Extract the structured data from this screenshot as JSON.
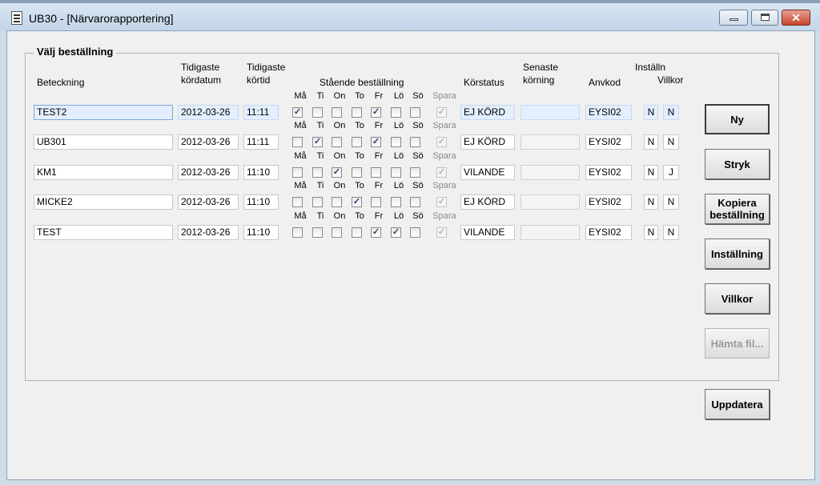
{
  "window": {
    "title": "UB30 - [Närvarorapportering]",
    "controls": [
      "minimize-icon",
      "maximize-icon",
      "close-icon"
    ]
  },
  "group": {
    "title": "Välj beställning"
  },
  "headers": {
    "beteckning": "Beteckning",
    "tidigaste_kordatum_1": "Tidigaste",
    "tidigaste_kordatum_2": "kördatum",
    "tidigaste_kortid_1": "Tidigaste",
    "tidigaste_kortid_2": "körtid",
    "staende": "Stående beställning",
    "korstatus": "Körstatus",
    "senaste_1": "Senaste",
    "senaste_2": "körning",
    "anvkod": "Anvkod",
    "installn": "Inställn",
    "villkor": "Villkor"
  },
  "days": [
    "Må",
    "Ti",
    "On",
    "To",
    "Fr",
    "Lö",
    "Sö"
  ],
  "spara_label": "Spara",
  "rows": [
    {
      "beteckning": "TEST2",
      "kordatum": "2012-03-26",
      "kortid": "11:11",
      "checks": [
        true,
        false,
        false,
        false,
        true,
        false,
        false
      ],
      "spara": true,
      "korstatus": "EJ KÖRD",
      "senaste": "",
      "anvkod": "EYSI02",
      "installn": "N",
      "villkor": "N"
    },
    {
      "beteckning": "UB301",
      "kordatum": "2012-03-26",
      "kortid": "11:11",
      "checks": [
        false,
        true,
        false,
        false,
        true,
        false,
        false
      ],
      "spara": true,
      "korstatus": "EJ KÖRD",
      "senaste": "",
      "anvkod": "EYSI02",
      "installn": "N",
      "villkor": "N"
    },
    {
      "beteckning": "KM1",
      "kordatum": "2012-03-26",
      "kortid": "11:10",
      "checks": [
        false,
        false,
        true,
        false,
        false,
        false,
        false
      ],
      "spara": true,
      "korstatus": "VILANDE",
      "senaste": "",
      "anvkod": "EYSI02",
      "installn": "N",
      "villkor": "J"
    },
    {
      "beteckning": "MICKE2",
      "kordatum": "2012-03-26",
      "kortid": "11:10",
      "checks": [
        false,
        false,
        false,
        true,
        false,
        false,
        false
      ],
      "spara": true,
      "korstatus": "EJ KÖRD",
      "senaste": "",
      "anvkod": "EYSI02",
      "installn": "N",
      "villkor": "N"
    },
    {
      "beteckning": "TEST",
      "kordatum": "2012-03-26",
      "kortid": "11:10",
      "checks": [
        false,
        false,
        false,
        false,
        true,
        true,
        false
      ],
      "spara": true,
      "korstatus": "VILANDE",
      "senaste": "",
      "anvkod": "EYSI02",
      "installn": "N",
      "villkor": "N"
    }
  ],
  "buttons": {
    "ny": "Ny",
    "stryk": "Stryk",
    "kopiera_1": "Kopiera",
    "kopiera_2": "beställning",
    "installning": "Inställning",
    "villkor": "Villkor",
    "hamta": "Hämta fil...",
    "uppdatera": "Uppdatera"
  }
}
